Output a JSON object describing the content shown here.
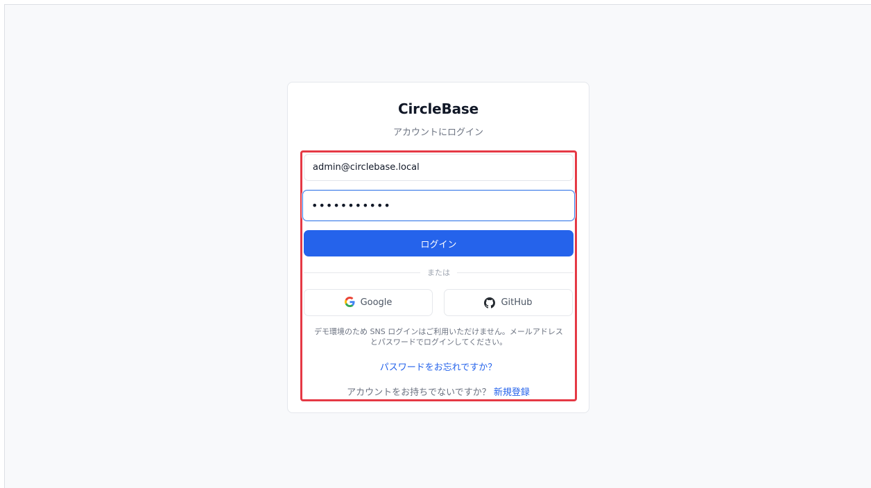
{
  "brand": {
    "name": "CircleBase",
    "subtitle": "アカウントにログイン"
  },
  "form": {
    "email_value": "admin@circlebase.local",
    "password_mask": "•••••••••••",
    "login_label": "ログイン",
    "divider_label": "または"
  },
  "sso": {
    "google_label": "Google",
    "github_label": "GitHub"
  },
  "notice": {
    "line1": "デモ環境のため SNS ログインはご利用いただけません。メールアドレス",
    "line2": "とパスワードでログインしてください。"
  },
  "links": {
    "forgot_password": "パスワードをお忘れですか？",
    "no_account": "アカウントをお持ちでないですか？",
    "signup": "新規登録"
  },
  "colors": {
    "primary": "#2563eb",
    "highlight": "#e53945",
    "background": "#f8f9fb"
  },
  "icons": {
    "google": "google-icon",
    "github": "github-icon"
  }
}
